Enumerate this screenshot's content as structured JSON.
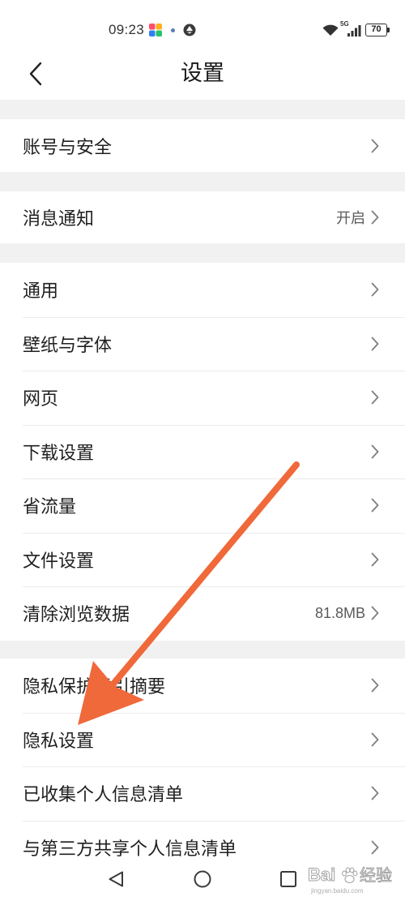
{
  "status_bar": {
    "time": "09:23",
    "network": "5G",
    "battery": "70",
    "icons": [
      "app-notification-icon",
      "notification-dot",
      "app-status-icon",
      "wifi-icon",
      "cellular-signal-icon",
      "battery-icon"
    ]
  },
  "header": {
    "back_icon": "chevron-left-icon",
    "title": "设置"
  },
  "sections": [
    {
      "rows": [
        {
          "label": "账号与安全"
        }
      ]
    },
    {
      "rows": [
        {
          "label": "消息通知",
          "value": "开启"
        }
      ]
    },
    {
      "rows": [
        {
          "label": "通用"
        },
        {
          "label": "壁纸与字体"
        },
        {
          "label": "网页"
        },
        {
          "label": "下载设置"
        },
        {
          "label": "省流量"
        },
        {
          "label": "文件设置"
        },
        {
          "label": "清除浏览数据",
          "value": "81.8MB"
        }
      ]
    },
    {
      "rows": [
        {
          "label": "隐私保护指引摘要"
        },
        {
          "label": "隐私设置"
        },
        {
          "label": "已收集个人信息清单"
        },
        {
          "label": "与第三方共享个人信息清单"
        }
      ]
    }
  ],
  "row_trailing_icon": "chevron-right-icon",
  "nav_bar": {
    "icons": [
      "nav-back-icon",
      "nav-home-icon",
      "nav-recents-icon"
    ]
  },
  "annotation": {
    "icon": "annotation-arrow",
    "color": "#f0693a"
  },
  "watermark": {
    "logo_text": "Bai",
    "product": "经验",
    "url": "jingyan.baidu.com"
  },
  "colors": {
    "background": "#ffffff",
    "separator": "#f1f1f1",
    "divider": "#ebebeb",
    "text_primary": "#1f1f1f",
    "text_secondary": "#5a5a5a",
    "chevron": "#7d7d7d"
  }
}
